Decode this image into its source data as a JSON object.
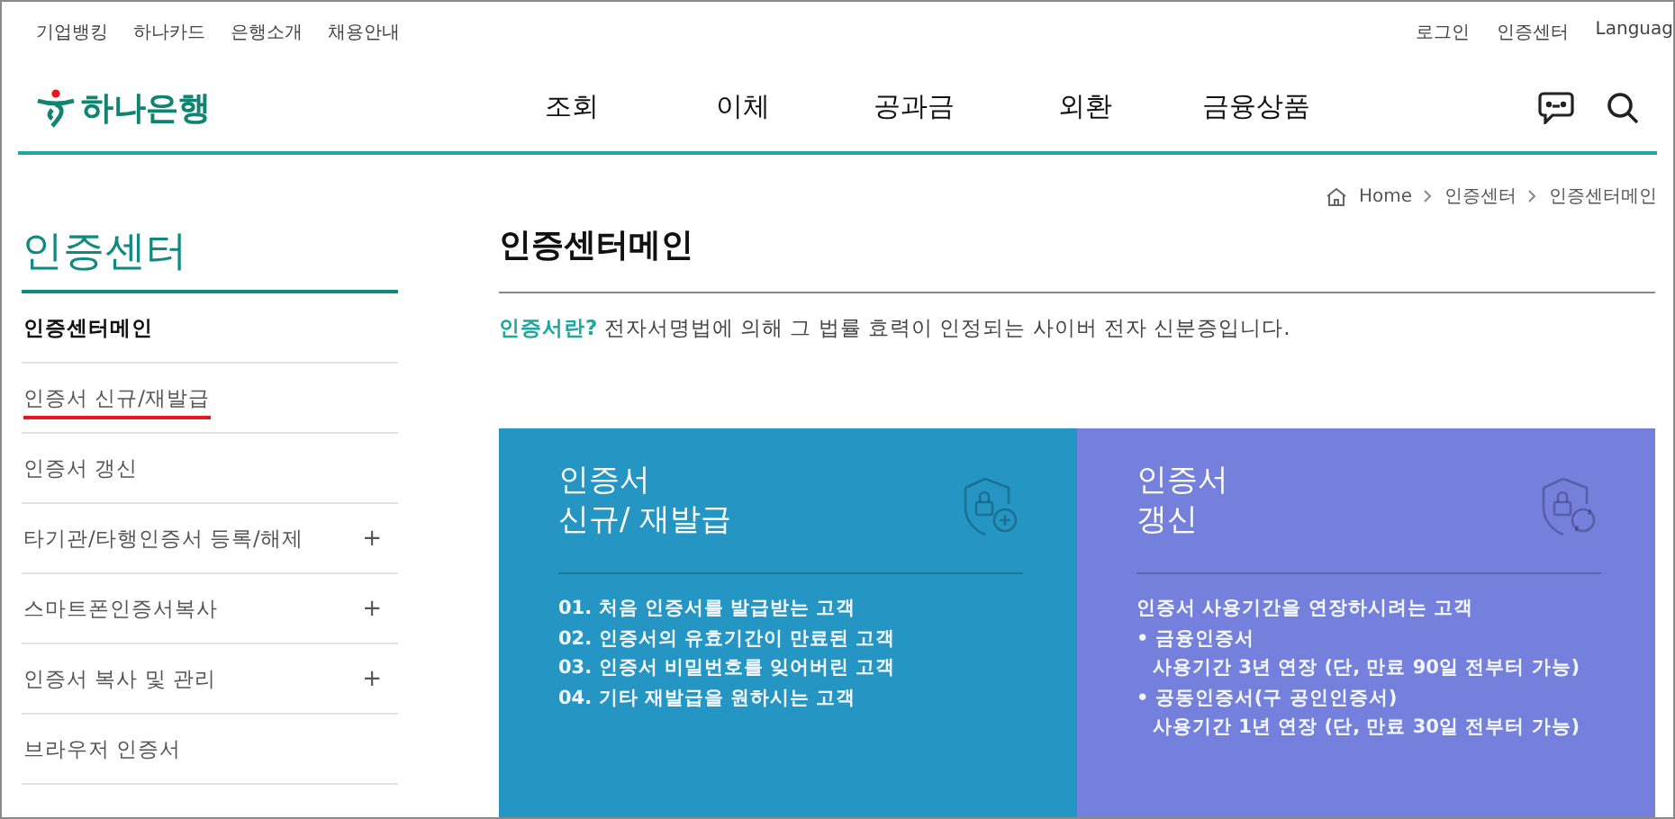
{
  "utility_links": [
    "기업뱅킹",
    "하나카드",
    "은행소개",
    "채용안내"
  ],
  "account_links": [
    "로그인",
    "인증센터",
    "Languag"
  ],
  "logo": {
    "text": "하나은행"
  },
  "main_nav": [
    "조회",
    "이체",
    "공과금",
    "외환",
    "금융상품"
  ],
  "breadcrumb": [
    "Home",
    "인증센터",
    "인증센터메인"
  ],
  "sidebar": {
    "title": "인증센터",
    "items": [
      {
        "label": "인증센터메인",
        "selected": true,
        "underlined": false
      },
      {
        "label": "인증서 신규/재발급",
        "selected": false,
        "underlined": true
      },
      {
        "label": "인증서 갱신",
        "selected": false,
        "underlined": false
      },
      {
        "label": "타기관/타행인증서 등록/해제",
        "selected": false,
        "underlined": false,
        "toggle": "+"
      },
      {
        "label": "스마트폰인증서복사",
        "selected": false,
        "underlined": false,
        "toggle": "+"
      },
      {
        "label": "인증서 복사 및 관리",
        "selected": false,
        "underlined": false,
        "toggle": "+"
      },
      {
        "label": "브라우저 인증서",
        "selected": false,
        "underlined": false
      }
    ]
  },
  "page_title": "인증센터메인",
  "intro": {
    "term": "인증서란?",
    "text": "전자서명법에 의해 그 법률 효력이 인정되는 사이버 전자 신분증입니다."
  },
  "cards": [
    {
      "title": [
        "인증서",
        "신규/ 재발급"
      ],
      "color": "#2596c4",
      "lines": [
        {
          "kind": "item",
          "text": "01. 처음 인증서를 발급받는 고객"
        },
        {
          "kind": "item",
          "text": "02. 인증서의 유효기간이 만료된 고객"
        },
        {
          "kind": "item",
          "text": "03. 인증서 비밀번호를 잊어버린 고객"
        },
        {
          "kind": "item",
          "text": "04. 기타 재발급을 원하시는 고객"
        }
      ]
    },
    {
      "title": [
        "인증서",
        "갱신"
      ],
      "color": "#7480dc",
      "lines": [
        {
          "kind": "item",
          "text": "인증서 사용기간을 연장하시려는 고객"
        },
        {
          "kind": "item",
          "text": "• 금융인증서"
        },
        {
          "kind": "sub",
          "text": "사용기간 3년 연장 (단, 만료 90일 전부터 가능)"
        },
        {
          "kind": "item",
          "text": "• 공동인증서(구 공인인증서)"
        },
        {
          "kind": "sub",
          "text": "사용기간 1년 연장 (단, 만료 30일 전부터 가능)"
        }
      ]
    }
  ]
}
